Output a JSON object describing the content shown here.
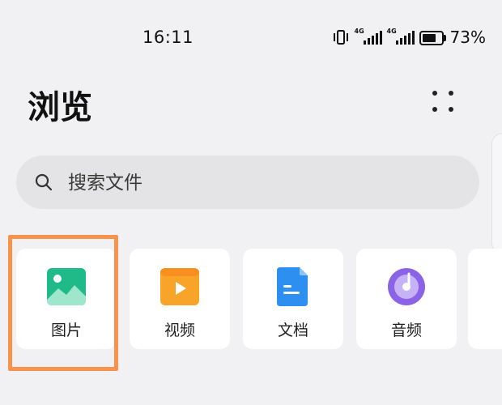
{
  "status_bar": {
    "time": "16:11",
    "battery_percent": "73%",
    "battery_level": 0.73,
    "signal_1": "4G",
    "signal_2": "4G",
    "icons": [
      "vibrate-icon",
      "signal-icon",
      "signal-icon",
      "battery-icon"
    ]
  },
  "header": {
    "title": "浏览",
    "more_icon": "more-dots-icon"
  },
  "search": {
    "placeholder": "搜索文件",
    "icon": "search-icon"
  },
  "categories": [
    {
      "label": "图片",
      "icon": "image-icon",
      "color": "#1fba88"
    },
    {
      "label": "视频",
      "icon": "video-icon",
      "color": "#f7a429"
    },
    {
      "label": "文档",
      "icon": "document-icon",
      "color": "#2d8ff0"
    },
    {
      "label": "音频",
      "icon": "audio-icon",
      "color": "#8a63e6"
    }
  ],
  "highlight": {
    "target": "图片",
    "color": "#f7934a"
  }
}
